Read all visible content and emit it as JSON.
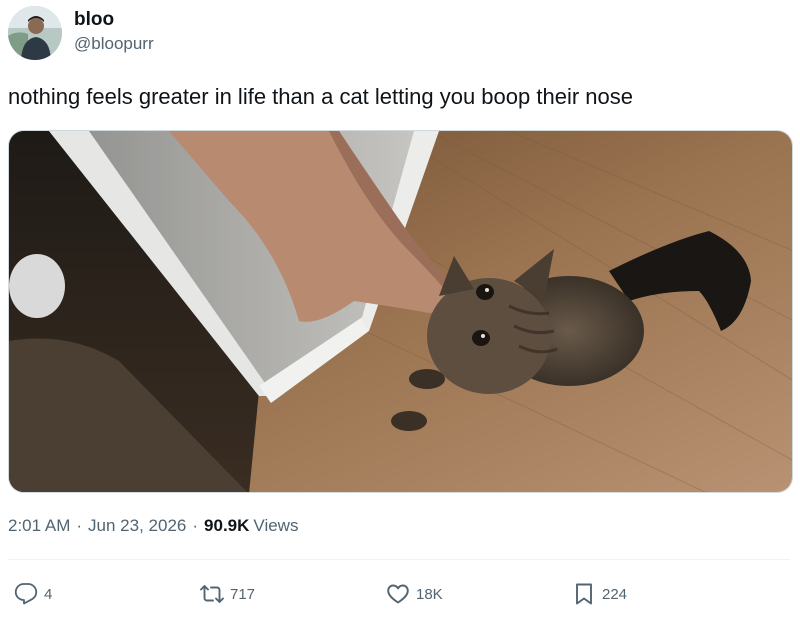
{
  "author": {
    "display_name": "bloo",
    "handle": "@bloopurr"
  },
  "tweet": {
    "text": "nothing feels greater in life than a cat letting you boop their nose"
  },
  "meta": {
    "time": "2:01 AM",
    "date": "Jun 23, 2026",
    "views_count": "90.9K",
    "views_label": "Views"
  },
  "actions": {
    "replies": "4",
    "retweets": "717",
    "likes": "18K",
    "bookmarks": "224"
  },
  "icons": [
    "reply-icon",
    "retweet-icon",
    "like-icon",
    "bookmark-icon"
  ],
  "colors": {
    "text_primary": "#0f1419",
    "text_secondary": "#536471"
  }
}
